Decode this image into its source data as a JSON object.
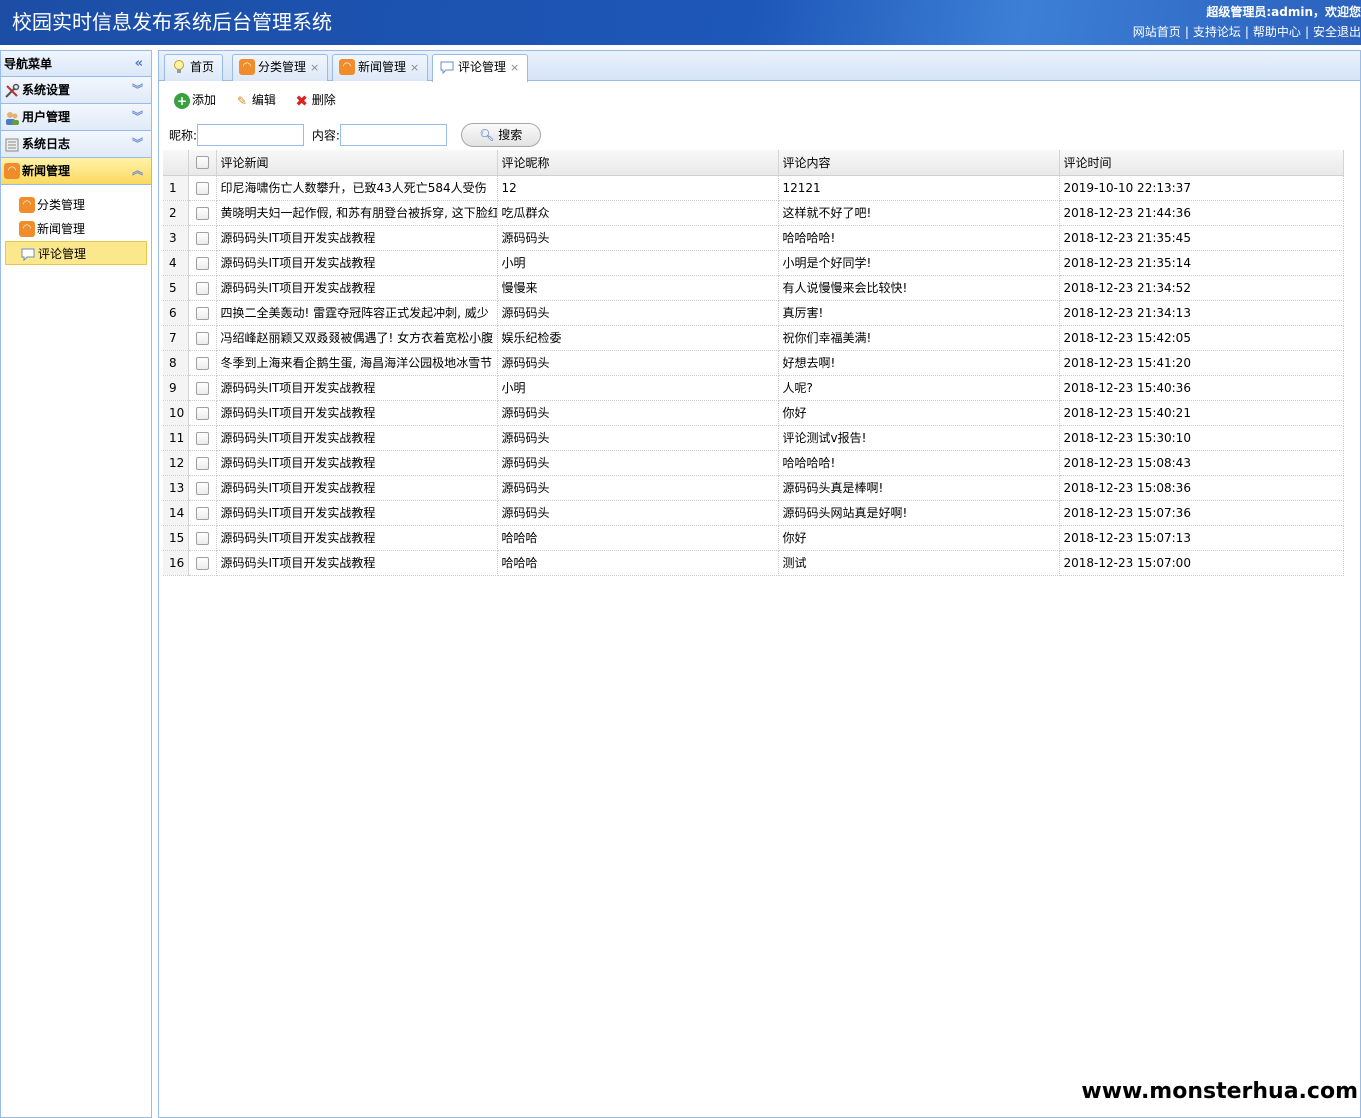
{
  "header": {
    "title": "校园实时信息发布系统后台管理系统",
    "user": "超级管理员:admin，欢迎您",
    "links": [
      "网站首页",
      "支持论坛",
      "帮助中心",
      "安全退出"
    ]
  },
  "sidebar": {
    "title": "导航菜单",
    "sections": [
      "系统设置",
      "用户管理",
      "系统日志",
      "新闻管理"
    ],
    "sub_items": [
      "分类管理",
      "新闻管理",
      "评论管理"
    ]
  },
  "tabs": [
    {
      "label": "首页"
    },
    {
      "label": "分类管理"
    },
    {
      "label": "新闻管理"
    },
    {
      "label": "评论管理"
    }
  ],
  "toolbar": {
    "add": "添加",
    "edit": "编辑",
    "delete": "删除"
  },
  "search": {
    "nickname_label": "昵称:",
    "content_label": "内容:",
    "nickname_value": "",
    "content_value": "",
    "button": "搜索"
  },
  "grid": {
    "columns": [
      "评论新闻",
      "评论昵称",
      "评论内容",
      "评论时间"
    ],
    "rows": [
      {
        "n": "1",
        "news": "印尼海啸伤亡人数攀升，已致43人死亡584人受伤",
        "nick": "12",
        "content": "12121",
        "time": "2019-10-10 22:13:37"
      },
      {
        "n": "2",
        "news": "黄晓明夫妇一起作假, 和苏有朋登台被拆穿, 这下脸红",
        "nick": "吃瓜群众",
        "content": "这样就不好了吧!",
        "time": "2018-12-23 21:44:36"
      },
      {
        "n": "3",
        "news": "源码码头IT项目开发实战教程",
        "nick": "源码码头",
        "content": "哈哈哈哈!",
        "time": "2018-12-23 21:35:45"
      },
      {
        "n": "4",
        "news": "源码码头IT项目开发实战教程",
        "nick": "小明",
        "content": "小明是个好同学!",
        "time": "2018-12-23 21:35:14"
      },
      {
        "n": "5",
        "news": "源码码头IT项目开发实战教程",
        "nick": "慢慢来",
        "content": "有人说慢慢来会比较快!",
        "time": "2018-12-23 21:34:52"
      },
      {
        "n": "6",
        "news": "四换二全美轰动! 雷霆夺冠阵容正式发起冲刺, 威少",
        "nick": "源码码头",
        "content": "真厉害!",
        "time": "2018-12-23 21:34:13"
      },
      {
        "n": "7",
        "news": "冯绍峰赵丽颖又双叒叕被偶遇了! 女方衣着宽松小腹",
        "nick": "娱乐纪检委",
        "content": "祝你们幸福美满!",
        "time": "2018-12-23 15:42:05"
      },
      {
        "n": "8",
        "news": "冬季到上海来看企鹅生蛋, 海昌海洋公园极地冰雪节",
        "nick": "源码码头",
        "content": "好想去啊!",
        "time": "2018-12-23 15:41:20"
      },
      {
        "n": "9",
        "news": "源码码头IT项目开发实战教程",
        "nick": "小明",
        "content": "人呢?",
        "time": "2018-12-23 15:40:36"
      },
      {
        "n": "10",
        "news": "源码码头IT项目开发实战教程",
        "nick": "源码码头",
        "content": "你好",
        "time": "2018-12-23 15:40:21"
      },
      {
        "n": "11",
        "news": "源码码头IT项目开发实战教程",
        "nick": "源码码头",
        "content": "评论测试v报告!",
        "time": "2018-12-23 15:30:10"
      },
      {
        "n": "12",
        "news": "源码码头IT项目开发实战教程",
        "nick": "源码码头",
        "content": "哈哈哈哈!",
        "time": "2018-12-23 15:08:43"
      },
      {
        "n": "13",
        "news": "源码码头IT项目开发实战教程",
        "nick": "源码码头",
        "content": "源码码头真是棒啊!",
        "time": "2018-12-23 15:08:36"
      },
      {
        "n": "14",
        "news": "源码码头IT项目开发实战教程",
        "nick": "源码码头",
        "content": "源码码头网站真是好啊!",
        "time": "2018-12-23 15:07:36"
      },
      {
        "n": "15",
        "news": "源码码头IT项目开发实战教程",
        "nick": "哈哈哈",
        "content": "你好",
        "time": "2018-12-23 15:07:13"
      },
      {
        "n": "16",
        "news": "源码码头IT项目开发实战教程",
        "nick": "哈哈哈",
        "content": "测试",
        "time": "2018-12-23 15:07:00"
      }
    ]
  },
  "watermark": "www.monsterhua.com",
  "icons": {
    "tab_home": "bulb-icon",
    "rss": "rss-icon",
    "comment": "comment-icon",
    "settings": "tools-icon",
    "users": "users-icon",
    "log": "log-icon"
  }
}
